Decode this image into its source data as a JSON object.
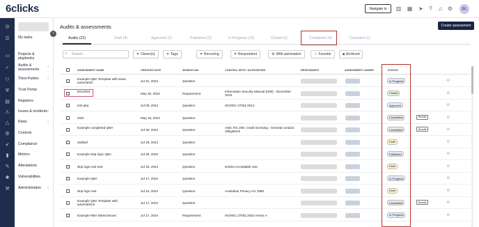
{
  "brand": {
    "logo": "6clicks"
  },
  "topbar": {
    "navigate_label": "Navigate to",
    "avatar_initials": "GL"
  },
  "sidebar": {
    "items": [
      {
        "label": "My tasks"
      },
      {
        "label": "Projects & playbooks"
      },
      {
        "label": "Audits & assessments"
      },
      {
        "label": "Third-Parties"
      },
      {
        "label": "Trust Portal"
      },
      {
        "label": "Registers"
      },
      {
        "label": "Issues & incidents"
      },
      {
        "label": "Risks"
      },
      {
        "label": "Controls"
      },
      {
        "label": "Compliance"
      },
      {
        "label": "Metrics"
      },
      {
        "label": "Attestations"
      },
      {
        "label": "Vulnerabilities"
      },
      {
        "label": "Administration"
      }
    ]
  },
  "page": {
    "title": "Audits & assessments",
    "new_button": "Create assessment"
  },
  "tabs": [
    {
      "label": "Audits (22)"
    },
    {
      "label": "Draft (4)"
    },
    {
      "label": "Approved (1)"
    },
    {
      "label": "Published (2)"
    },
    {
      "label": "In Progress (10)"
    },
    {
      "label": "Closed (1)"
    },
    {
      "label": "Completed (4)"
    },
    {
      "label": "Canceled (1)"
    }
  ],
  "filters": {
    "search_placeholder": "Search",
    "buttons": [
      "Owner(s)",
      "Tags",
      "Recurring",
      "Respondent",
      "With automation",
      "Favorite",
      "Archived"
    ]
  },
  "table": {
    "headers": [
      "ASSESSMENT NAME",
      "CREATED DATE",
      "WORKFLOW",
      "CONTROL SETS / AUTHORITIES",
      "RESPONDENT",
      "ASSESSMENT OWNER",
      "STATUS"
    ],
    "rows": [
      {
        "name": "Example QBA Template with issue automation",
        "date": "Jul 31, 2024",
        "workflow": "Question",
        "controls": "",
        "status": "In Progress",
        "results": ""
      },
      {
        "name": "Dec2023",
        "date": "May 30, 2024",
        "workflow": "Requirement",
        "controls": "Information Security Manual (ISM) - December 2023",
        "status": "Closed",
        "results": ""
      },
      {
        "name": "test qba",
        "date": "Jul 09, 2024",
        "workflow": "Question",
        "controls": "ISO/IEC 27001:2013",
        "status": "Approved",
        "results": ""
      },
      {
        "name": "risks",
        "date": "May 15, 2024",
        "workflow": "Question",
        "controls": "",
        "status": "Completed",
        "results": "Results"
      },
      {
        "name": "Example completed QBA",
        "date": "Jul 30, 2024",
        "workflow": "Question",
        "controls": "ASIC RG 205: Credit licensing - General conduct obligations",
        "status": "Completed",
        "results": "Results"
      },
      {
        "name": "asdfasf",
        "date": "Jul 29, 2024",
        "workflow": "Question",
        "controls": "",
        "status": "Draft",
        "results": ""
      },
      {
        "name": "Example skip logic QBA",
        "date": "Jul 29, 2024",
        "workflow": "Question",
        "controls": "",
        "status": "Published",
        "results": ""
      },
      {
        "name": "skip logic test test",
        "date": "Jul 25, 2024",
        "workflow": "Question",
        "controls": "6clicks Acceptable Use",
        "status": "Draft",
        "results": ""
      },
      {
        "name": "Example QBA",
        "date": "Jul 17, 2024",
        "workflow": "Question",
        "controls": "",
        "status": "In Progress",
        "results": ""
      },
      {
        "name": "skip logic test",
        "date": "Jul 24, 2024",
        "workflow": "Question",
        "controls": "Australian Privacy Act 1988",
        "status": "Draft",
        "results": ""
      },
      {
        "name": "Example QBA Template with automations",
        "date": "Jul 17, 2024",
        "workflow": "Question",
        "controls": "",
        "status": "Completed",
        "results": "Results"
      },
      {
        "name": "Example RBA linked issues",
        "date": "Jul 17, 2024",
        "workflow": "Requirement",
        "controls": "ISO/IEC 27001:2022 Annex A",
        "status": "In Progress",
        "results": ""
      }
    ]
  },
  "status_colors": {
    "In Progress": "#dfe9f6",
    "Closed": "#dff2df",
    "Approved": "#e3ecf8",
    "Completed": "#e6e6e6",
    "Draft": "#fbf0c8",
    "Published": "#dde7f4"
  },
  "accent": {
    "highlight": "#b03030",
    "brand_navy": "#1a2442"
  }
}
